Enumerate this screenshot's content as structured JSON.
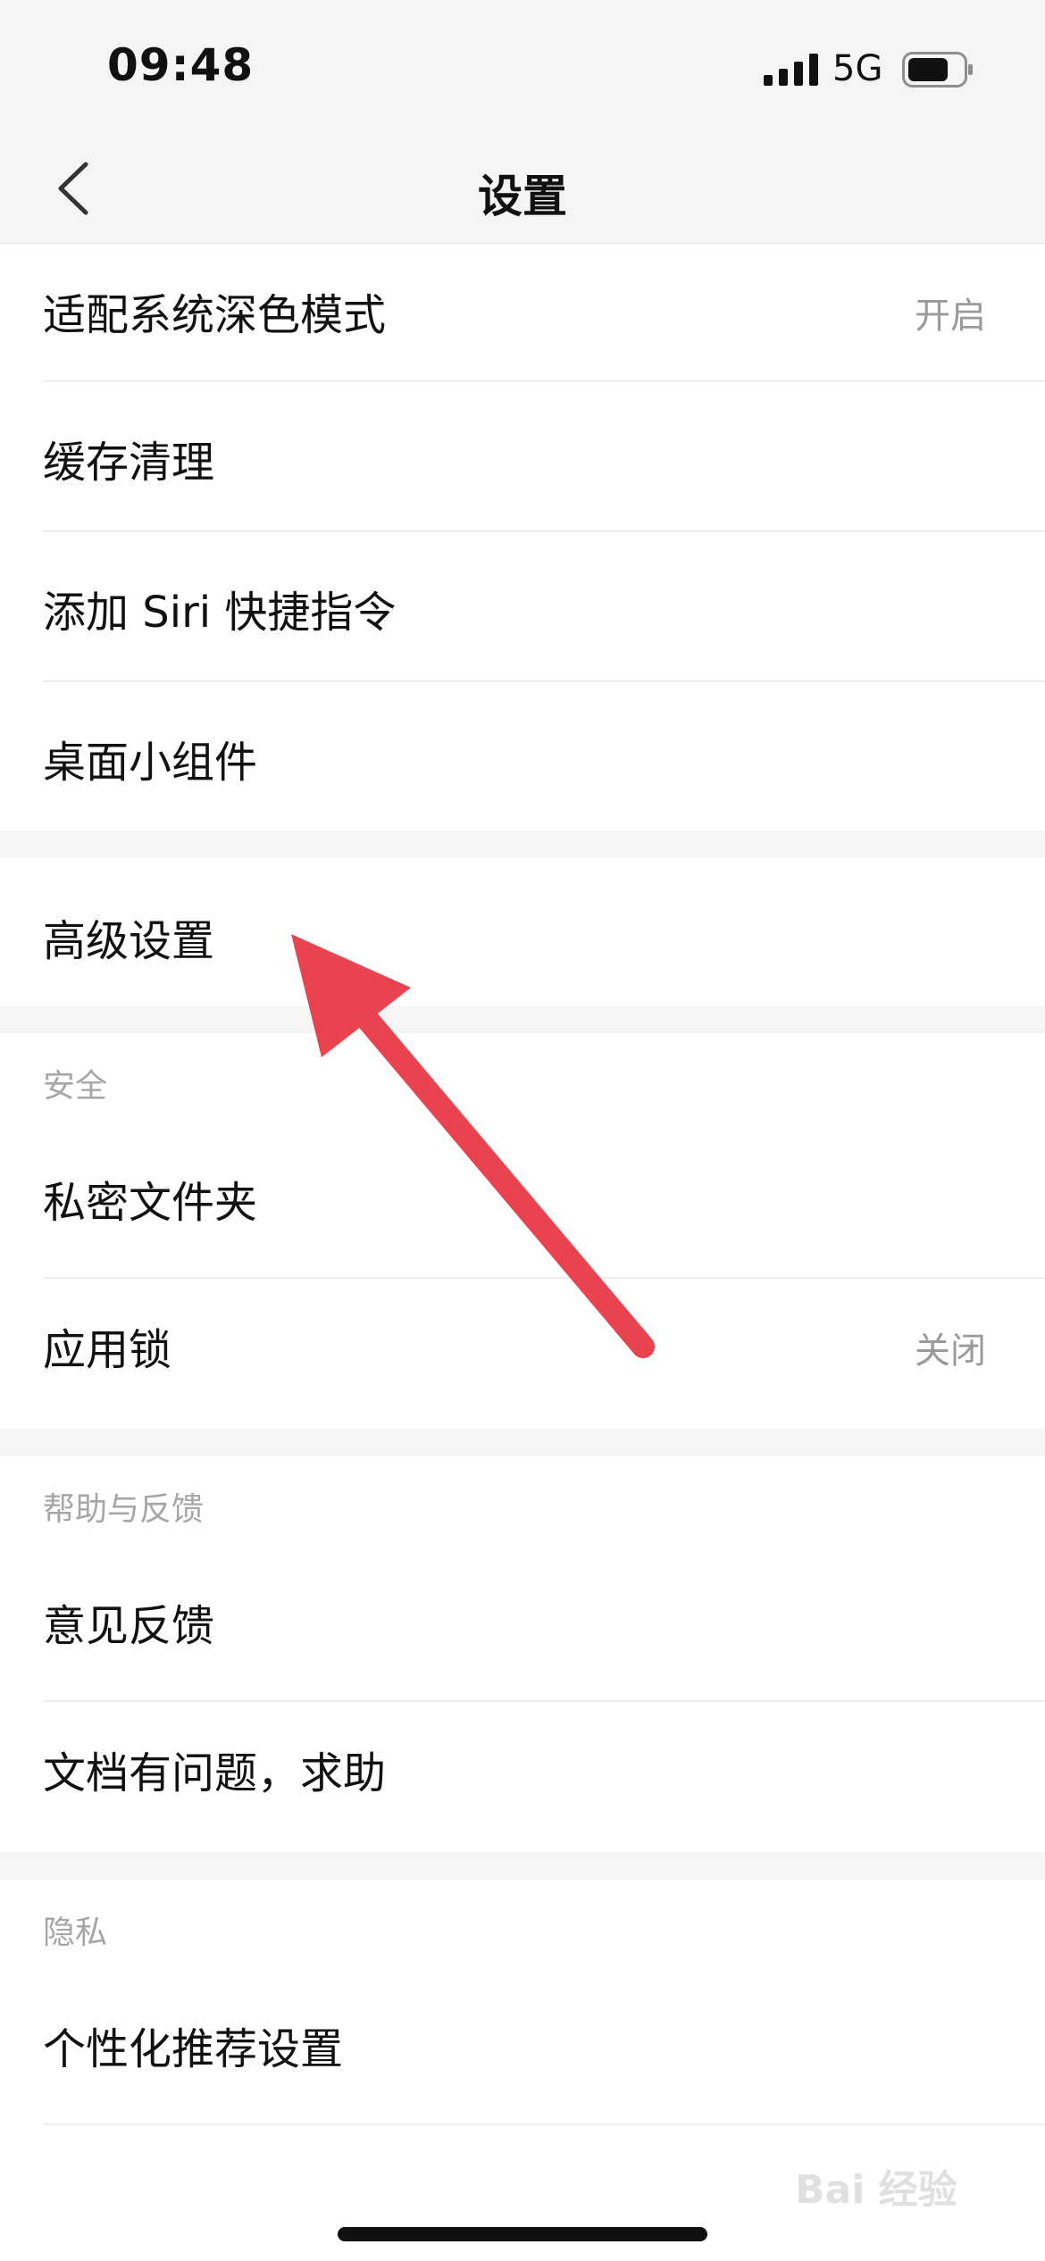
{
  "status_bar": {
    "time": "09:48",
    "network": "5G"
  },
  "nav": {
    "title": "设置"
  },
  "group1": {
    "rows": [
      {
        "label": "适配系统深色模式",
        "value": "开启"
      },
      {
        "label": "缓存清理"
      },
      {
        "label": "添加 Siri 快捷指令"
      },
      {
        "label": "桌面小组件"
      }
    ]
  },
  "group2": {
    "rows": [
      {
        "label": "高级设置"
      }
    ]
  },
  "security": {
    "title": "安全",
    "rows": [
      {
        "label": "私密文件夹"
      },
      {
        "label": "应用锁",
        "value": "关闭"
      }
    ]
  },
  "help": {
    "title": "帮助与反馈",
    "rows": [
      {
        "label": "意见反馈"
      },
      {
        "label": "文档有问题，求助"
      }
    ]
  },
  "privacy": {
    "title": "隐私",
    "rows": [
      {
        "label": "个性化推荐设置"
      }
    ]
  },
  "watermark": {
    "text": "Bai 经验"
  },
  "colors": {
    "arrow": "#e8434f",
    "background": "#f5f5f5",
    "secondary_text": "#9a9a9a"
  }
}
